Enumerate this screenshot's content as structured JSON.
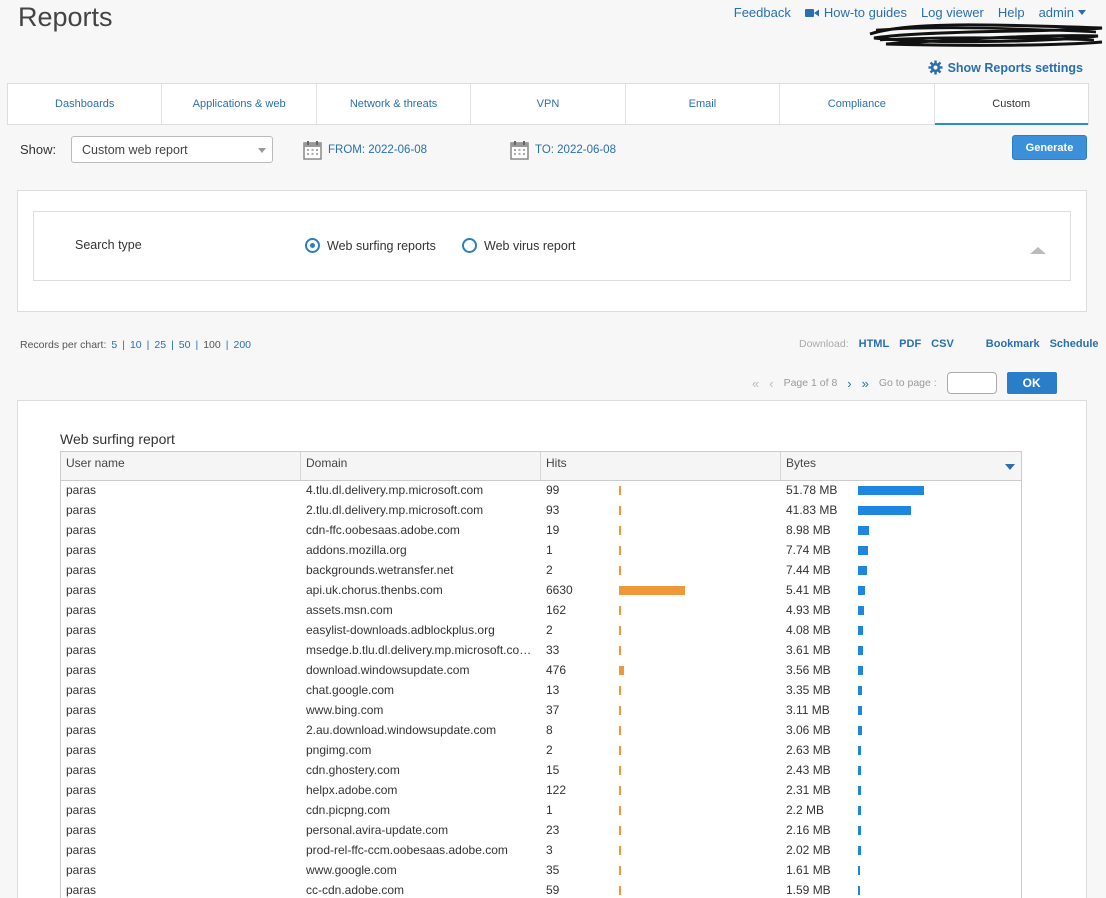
{
  "header": {
    "title": "Reports",
    "nav": [
      "Feedback",
      "How-to guides",
      "Log viewer",
      "Help",
      "admin"
    ],
    "settings_label": "Show Reports settings"
  },
  "tabs": [
    {
      "label": "Dashboards"
    },
    {
      "label": "Applications & web"
    },
    {
      "label": "Network & threats"
    },
    {
      "label": "VPN"
    },
    {
      "label": "Email"
    },
    {
      "label": "Compliance"
    },
    {
      "label": "Custom",
      "active": true
    }
  ],
  "filters": {
    "show_label": "Show:",
    "report_select": "Custom web report",
    "from": "FROM: 2022-06-08",
    "to": "TO: 2022-06-08",
    "generate_label": "Generate"
  },
  "search": {
    "label": "Search type",
    "options": [
      "Web surfing reports",
      "Web virus report"
    ],
    "selected": "Web surfing reports"
  },
  "records": {
    "label": "Records per chart:",
    "options": [
      "5",
      "10",
      "25",
      "50",
      "100",
      "200"
    ],
    "current": "100"
  },
  "download": {
    "label": "Download:",
    "formats": [
      "HTML",
      "PDF",
      "CSV"
    ],
    "bookmark": "Bookmark",
    "schedule": "Schedule"
  },
  "pager": {
    "page_text": "Page 1 of 8",
    "goto_label": "Go to page :",
    "ok_label": "OK"
  },
  "report": {
    "title": "Web surfing report",
    "columns": [
      "User name",
      "Domain",
      "Hits",
      "Bytes"
    ],
    "max_hits": 6630,
    "max_bytes": 51.78,
    "rows": [
      {
        "user": "paras",
        "domain": "4.tlu.dl.delivery.mp.microsoft.com",
        "hits": 99,
        "bytes": "51.78 MB",
        "bytes_mb": 51.78
      },
      {
        "user": "paras",
        "domain": "2.tlu.dl.delivery.mp.microsoft.com",
        "hits": 93,
        "bytes": "41.83 MB",
        "bytes_mb": 41.83
      },
      {
        "user": "paras",
        "domain": "cdn-ffc.oobesaas.adobe.com",
        "hits": 19,
        "bytes": "8.98 MB",
        "bytes_mb": 8.98
      },
      {
        "user": "paras",
        "domain": "addons.mozilla.org",
        "hits": 1,
        "bytes": "7.74 MB",
        "bytes_mb": 7.74
      },
      {
        "user": "paras",
        "domain": "backgrounds.wetransfer.net",
        "hits": 2,
        "bytes": "7.44 MB",
        "bytes_mb": 7.44
      },
      {
        "user": "paras",
        "domain": "api.uk.chorus.thenbs.com",
        "hits": 6630,
        "bytes": "5.41 MB",
        "bytes_mb": 5.41
      },
      {
        "user": "paras",
        "domain": "assets.msn.com",
        "hits": 162,
        "bytes": "4.93 MB",
        "bytes_mb": 4.93
      },
      {
        "user": "paras",
        "domain": "easylist-downloads.adblockplus.org",
        "hits": 2,
        "bytes": "4.08 MB",
        "bytes_mb": 4.08
      },
      {
        "user": "paras",
        "domain": "msedge.b.tlu.dl.delivery.mp.microsoft.co…",
        "hits": 33,
        "bytes": "3.61 MB",
        "bytes_mb": 3.61
      },
      {
        "user": "paras",
        "domain": "download.windowsupdate.com",
        "hits": 476,
        "bytes": "3.56 MB",
        "bytes_mb": 3.56
      },
      {
        "user": "paras",
        "domain": "chat.google.com",
        "hits": 13,
        "bytes": "3.35 MB",
        "bytes_mb": 3.35
      },
      {
        "user": "paras",
        "domain": "www.bing.com",
        "hits": 37,
        "bytes": "3.11 MB",
        "bytes_mb": 3.11
      },
      {
        "user": "paras",
        "domain": "2.au.download.windowsupdate.com",
        "hits": 8,
        "bytes": "3.06 MB",
        "bytes_mb": 3.06
      },
      {
        "user": "paras",
        "domain": "pngimg.com",
        "hits": 2,
        "bytes": "2.63 MB",
        "bytes_mb": 2.63
      },
      {
        "user": "paras",
        "domain": "cdn.ghostery.com",
        "hits": 15,
        "bytes": "2.43 MB",
        "bytes_mb": 2.43
      },
      {
        "user": "paras",
        "domain": "helpx.adobe.com",
        "hits": 122,
        "bytes": "2.31 MB",
        "bytes_mb": 2.31
      },
      {
        "user": "paras",
        "domain": "cdn.picpng.com",
        "hits": 1,
        "bytes": "2.2 MB",
        "bytes_mb": 2.2
      },
      {
        "user": "paras",
        "domain": "personal.avira-update.com",
        "hits": 23,
        "bytes": "2.16 MB",
        "bytes_mb": 2.16
      },
      {
        "user": "paras",
        "domain": "prod-rel-ffc-ccm.oobesaas.adobe.com",
        "hits": 3,
        "bytes": "2.02 MB",
        "bytes_mb": 2.02
      },
      {
        "user": "paras",
        "domain": "www.google.com",
        "hits": 35,
        "bytes": "1.61 MB",
        "bytes_mb": 1.61
      },
      {
        "user": "paras",
        "domain": "cc-cdn.adobe.com",
        "hits": 59,
        "bytes": "1.59 MB",
        "bytes_mb": 1.59
      }
    ]
  },
  "colors": {
    "accent": "#2a6fb0",
    "hits_bar": "#f0973a",
    "bytes_bar": "#1f86e0",
    "button": "#3c8fd9"
  }
}
